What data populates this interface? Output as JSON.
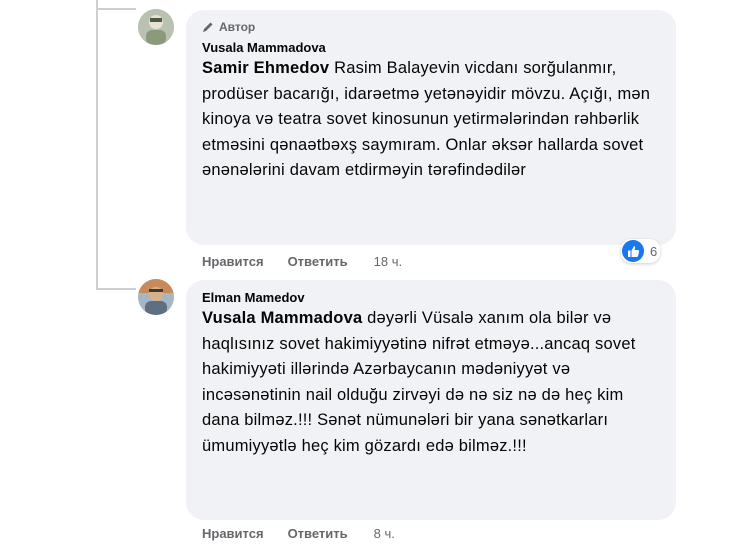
{
  "comments": [
    {
      "author_badge": "Автор",
      "author": "Vusala Mammadova",
      "mention": "Samir Ehmedov",
      "text": " Rasim Balayevin vicdanı sorğulanmır, prodüser bacarığı, idarəetmə yetənəyidir mövzu. Açığı, mən kinoya və teatra sovet kinosunun yetirmələrindən rəhbərlik etməsini qənaətbəxş saymıram. Onlar əksər hallarda sovet ənənələrini davam etdirməyin tərəfindədilər",
      "like_label": "Нравится",
      "reply_label": "Ответить",
      "time": "18 ч.",
      "reactions_count": "6",
      "reaction_icon": "like-icon"
    },
    {
      "author": "Elman Mamedov",
      "mention": "Vusala Mammadova",
      "text": " dəyərli Vüsalə xanım ola bilər və haqlısınız sovet hakimiyyətinə nifrət etməyə...ancaq sovet hakimiyyəti illərində Azərbaycanın mədəniyyət və incəsənətinin nail olduğu zirvəyi də nə siz nə də heç kim dana bilməz.!!! Sənət nümunələri bir yana sənətkarları ümumiyyətlə heç kim gözardı edə bilməz.!!!",
      "like_label": "Нравится",
      "reply_label": "Ответить",
      "time": "8 ч."
    }
  ],
  "colors": {
    "bubble": "#f0f2f5",
    "text": "#050505",
    "secondary": "#65676b",
    "like_blue": "#1877f2",
    "thread_line": "#ccd0d5"
  }
}
